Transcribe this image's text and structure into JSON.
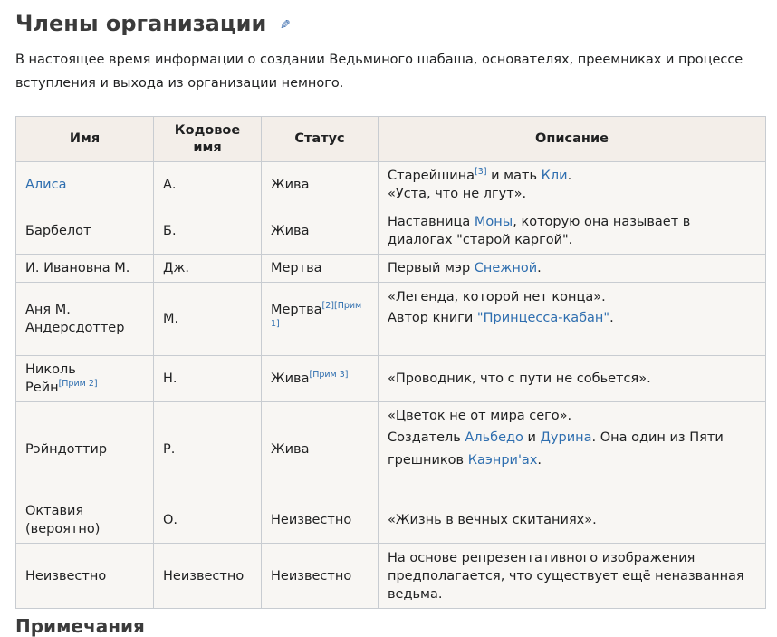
{
  "section": {
    "title": "Члены организации",
    "edit_icon": "pencil-icon"
  },
  "intro": "В настоящее время информации о создании Ведьминого шабаша, основателях, преемниках и процессе вступления и выхода из организации немного.",
  "table": {
    "headers": {
      "name": "Имя",
      "code_line1": "Кодовое",
      "code_line2": "имя",
      "status": "Статус",
      "description": "Описание"
    },
    "rows": [
      {
        "name_link": "Алиса",
        "code": "А.",
        "status": "Жива",
        "d1_pre": "Старейшина",
        "d1_ref": "[3]",
        "d1_mid": " и мать ",
        "d1_link": "Кли",
        "d1_post": ".",
        "d2": "«Уста, что не лгут»."
      },
      {
        "name": "Барбелот",
        "code": "Б.",
        "status": "Жива",
        "d_pre": "Наставница ",
        "d_link": "Моны",
        "d_post": ", которую она называет в диалогах \"старой каргой\"."
      },
      {
        "name": "И. Ивановна М.",
        "code": "Дж.",
        "status": "Мертва",
        "d_pre": "Первый мэр ",
        "d_link": "Снежной",
        "d_post": "."
      },
      {
        "name_line1": "Аня М.",
        "name_line2": "Андерсдоттер",
        "code": "М.",
        "status": "Мертва",
        "status_ref1": "[2]",
        "status_ref2": "[Прим 1]",
        "d1": "«Легенда, которой нет конца».",
        "d2_pre": "Автор книги ",
        "d2_link": "\"Принцесса-кабан\"",
        "d2_post": "."
      },
      {
        "name_line1": "Николь",
        "name_line2": "Рейн",
        "name_ref": "[Прим 2]",
        "code": "Н.",
        "status": "Жива",
        "status_ref": "[Прим 3]",
        "d": "«Проводник, что с пути не собьется»."
      },
      {
        "name": "Рэйндоттир",
        "code": "Р.",
        "status": "Жива",
        "d1": "«Цветок не от мира сего».",
        "d2_pre": "Создатель ",
        "d2_link1": "Альбедо",
        "d2_mid": " и ",
        "d2_link2": "Дурина",
        "d2_post": ". Она один из Пяти грешников ",
        "d2_link3": "Каэнри'ах",
        "d2_end": "."
      },
      {
        "name_line1": "Октавия",
        "name_line2": "(вероятно)",
        "code": "О.",
        "status": "Неизвестно",
        "d": "«Жизнь в вечных скитаниях»."
      },
      {
        "name": "Неизвестно",
        "code": "Неизвестно",
        "status": "Неизвестно",
        "d": "На основе репрезентативного изображения предполагается, что существует ещё неназванная ведьма."
      }
    ]
  },
  "next_heading": "Примечания"
}
